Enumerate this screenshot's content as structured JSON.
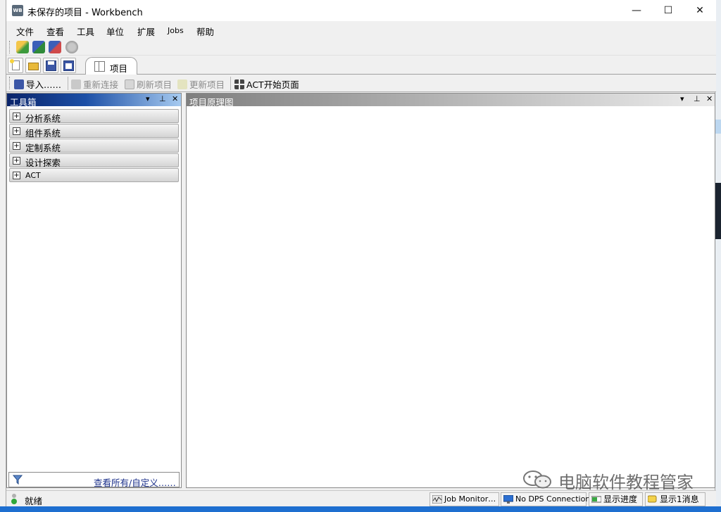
{
  "window": {
    "title": "未保存的项目 - Workbench",
    "icon_text": "WB",
    "min_glyph": "—",
    "max_glyph": "☐",
    "close_glyph": "✕"
  },
  "menu": [
    "文件",
    "查看",
    "工具",
    "单位",
    "扩展",
    "Jobs",
    "帮助"
  ],
  "project_tab": {
    "label": "项目"
  },
  "toolbar2": {
    "import": "导入……",
    "reconnect": "重新连接",
    "refresh": "刷新项目",
    "update": "更新项目",
    "act_start": "ACT开始页面"
  },
  "toolbox": {
    "title": "工具箱",
    "controls": {
      "dropdown": "▾",
      "pin": "⊥",
      "close": "✕"
    },
    "categories": [
      "分析系统",
      "组件系统",
      "定制系统",
      "设计探索",
      "ACT"
    ],
    "footer_link": "查看所有/自定义……"
  },
  "schematic": {
    "title": "项目原理图",
    "controls": {
      "dropdown": "▾",
      "pin": "⊥",
      "close": "✕"
    }
  },
  "statusbar": {
    "status": "就绪",
    "job_monitor": "Job Monitor…",
    "dps": "No DPS Connection",
    "progress": "显示进度",
    "messages": "显示1消息"
  },
  "watermark": "电脑软件教程管家",
  "colors": {
    "toolbox_header_start": "#0a246a",
    "toolbox_header_end": "#a6caf0",
    "link": "#1a2f8a"
  }
}
